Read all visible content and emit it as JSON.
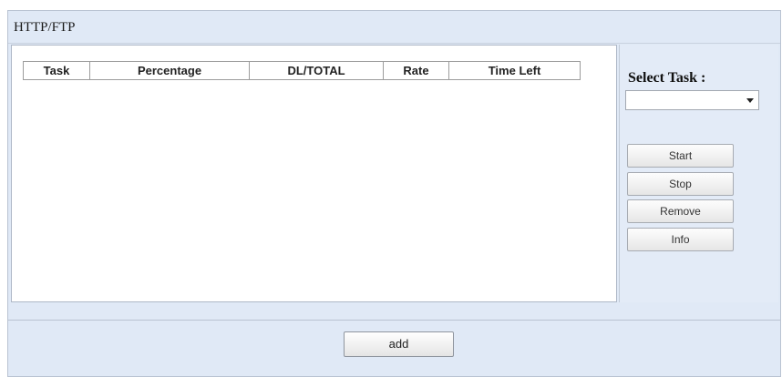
{
  "panel": {
    "title": "HTTP/FTP"
  },
  "table": {
    "columns": [
      "Task",
      "Percentage",
      "DL/TOTAL",
      "Rate",
      "Time Left"
    ],
    "rows": []
  },
  "side": {
    "select_label": "Select Task :",
    "select_value": "",
    "buttons": {
      "start": "Start",
      "stop": "Stop",
      "remove": "Remove",
      "info": "Info"
    }
  },
  "footer": {
    "add_label": "add"
  }
}
